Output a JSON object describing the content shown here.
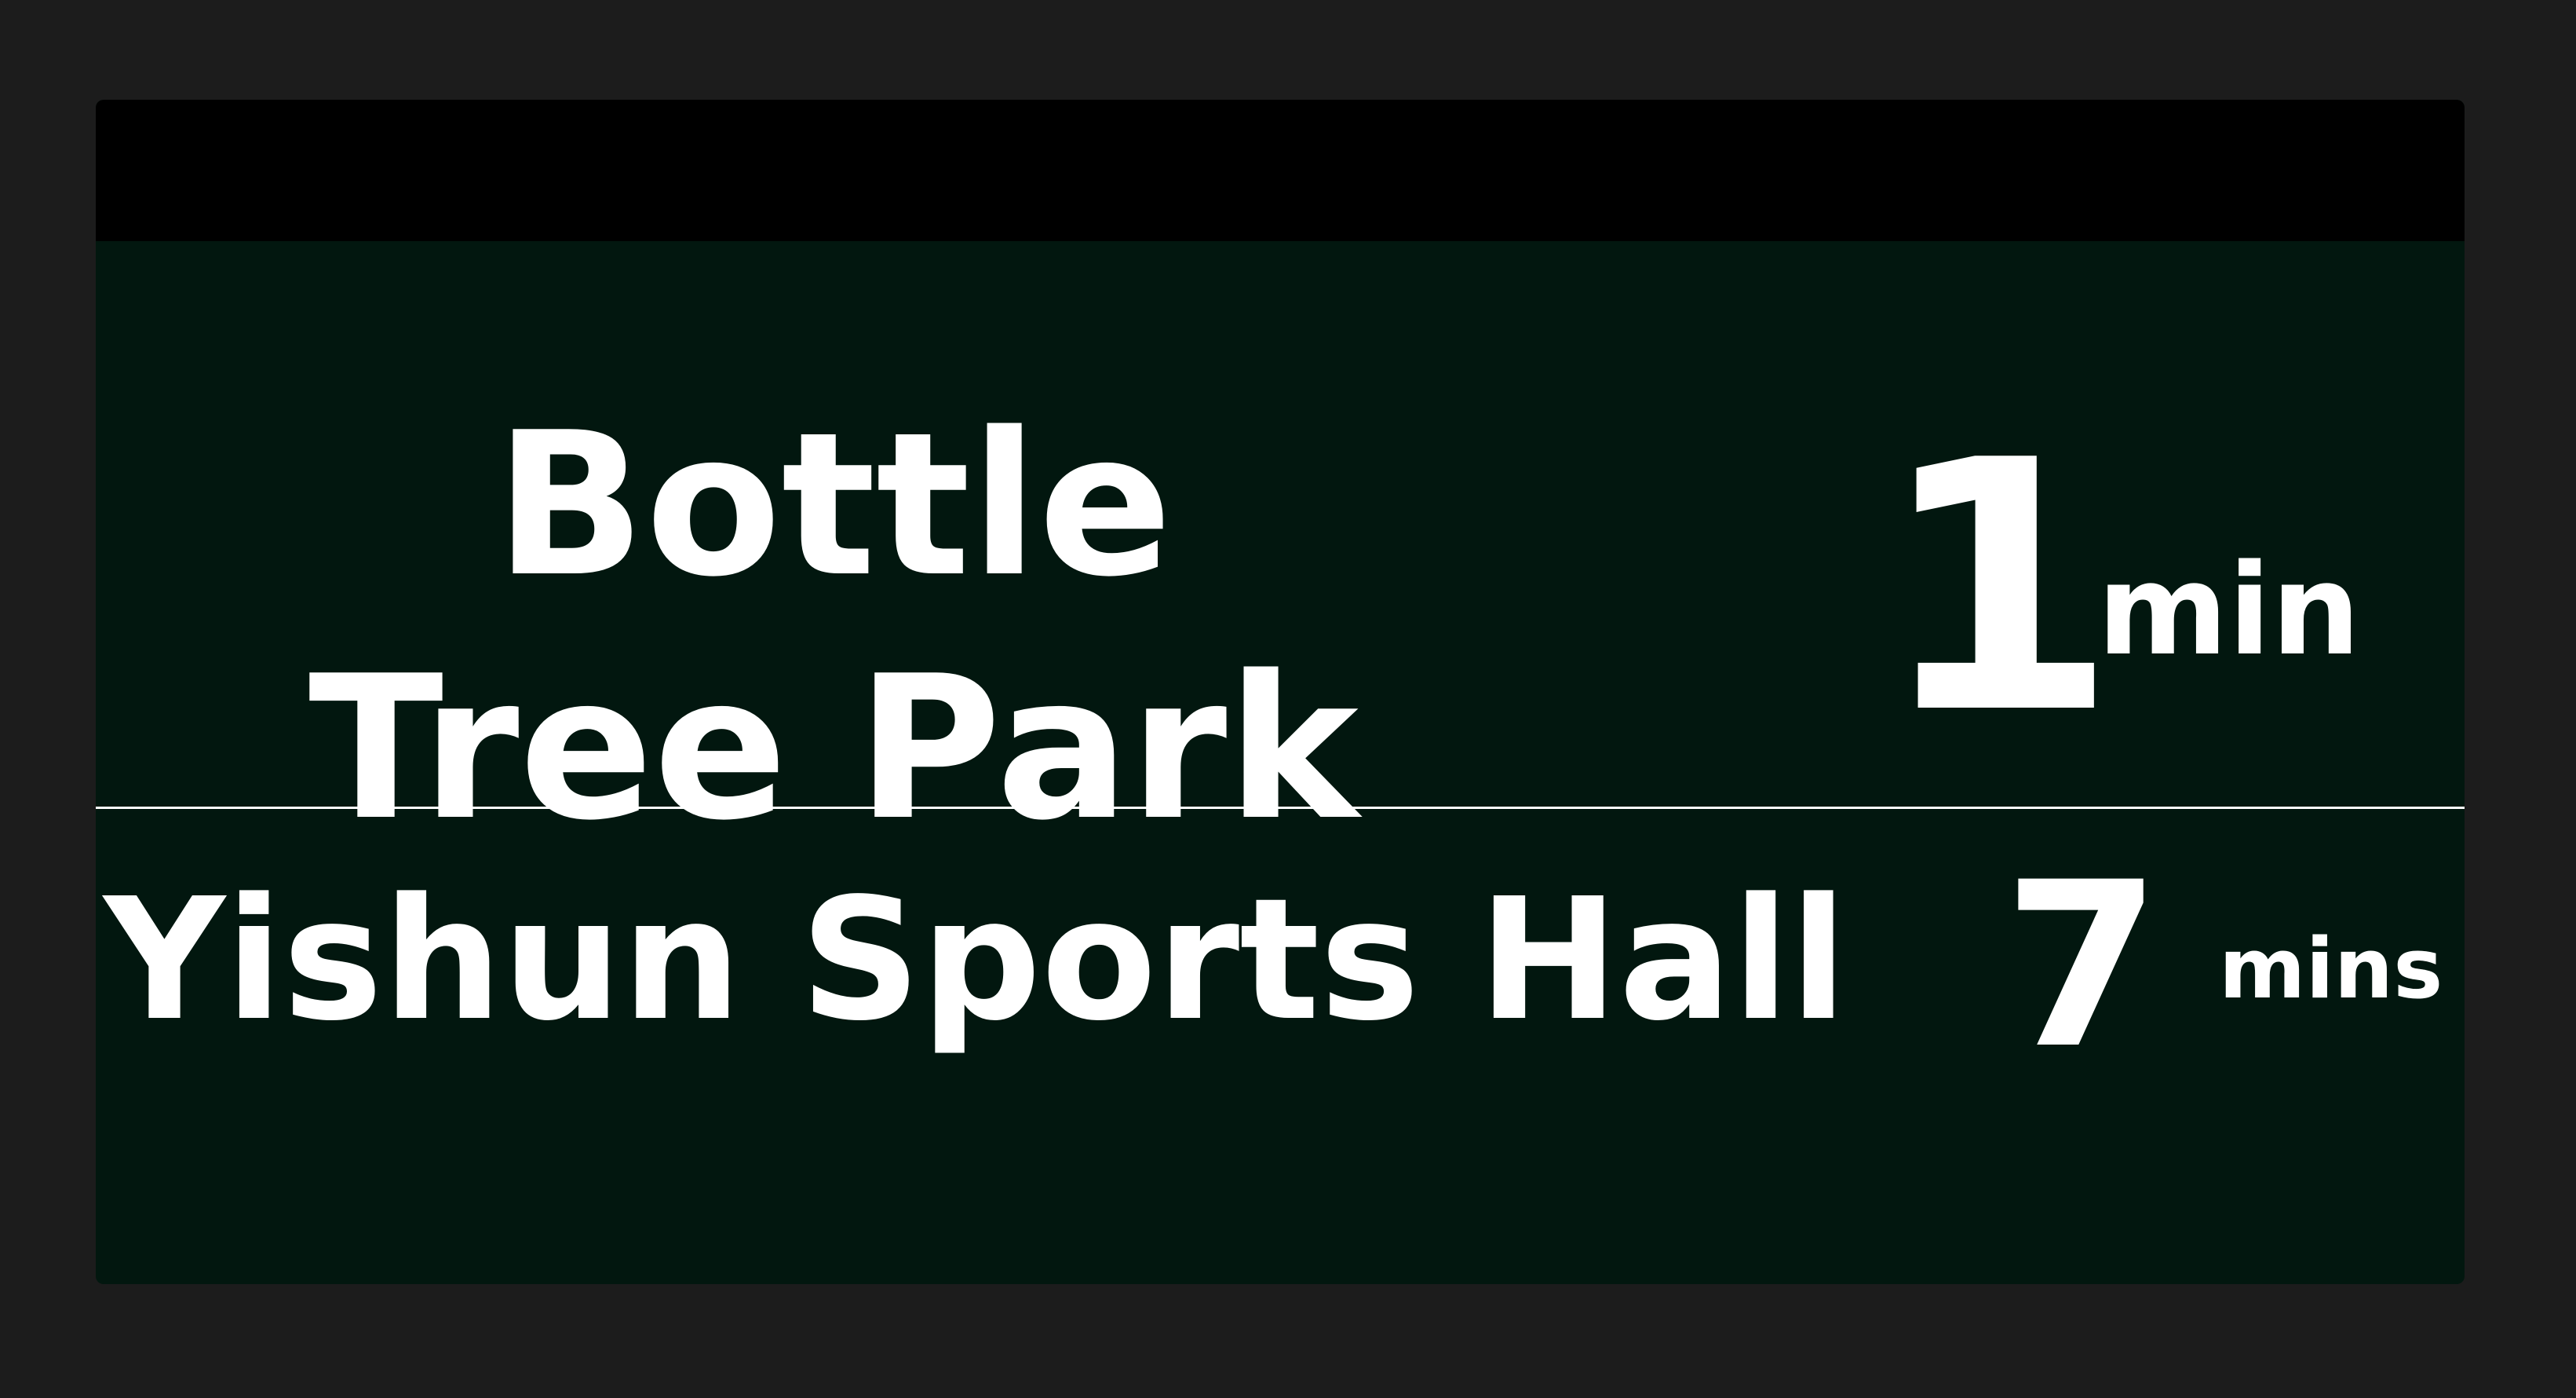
{
  "rows": [
    {
      "destination": "Bottle Tree Park",
      "eta_value": "1",
      "eta_unit": "min"
    },
    {
      "destination": "Yishun Sports Hall",
      "eta_value": "7",
      "eta_unit": "mins"
    }
  ],
  "colors": {
    "background": "#1c1c1c",
    "panel": "#02170f",
    "header": "#000000",
    "text": "#ffffff"
  }
}
